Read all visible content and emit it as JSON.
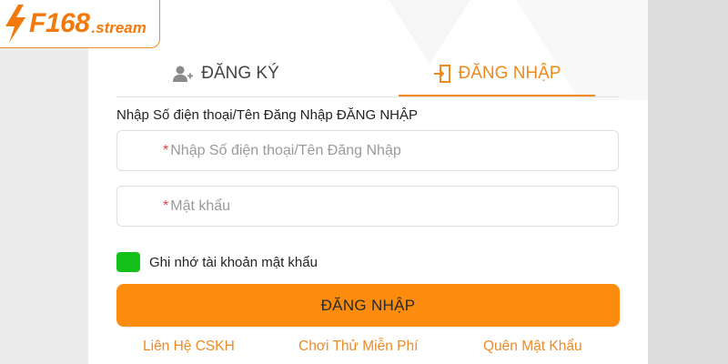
{
  "brand": {
    "name": "F168",
    "suffix": ".stream",
    "color": "#f27a0c"
  },
  "tabs": {
    "register_label": "ĐĂNG KÝ",
    "login_label": "ĐĂNG NHẬP",
    "active": "login"
  },
  "form": {
    "account_label": "Nhập Số điện thoại/Tên Đăng Nhập ĐĂNG NHẬP",
    "phone_placeholder": "Nhập Số điện thoại/Tên Đăng Nhập",
    "password_placeholder": "Mật khẩu",
    "required_mark": "*",
    "remember_label": "Ghi nhớ tài khoản mật khẩu",
    "remember_checked": true,
    "submit_label": "ĐĂNG NHẬP"
  },
  "links": {
    "support": "Liên Hệ CSKH",
    "trial": "Chơi Thử Miễn Phí",
    "forgot": "Quên Mật Khẩu"
  },
  "colors": {
    "accent": "#f08a1c",
    "button": "#fb8c0d",
    "checkbox": "#14c01a",
    "required": "#e0453b"
  },
  "icons": {
    "register": "add-user-icon",
    "login": "login-door-icon",
    "brand": "lightning-bolt-icon"
  }
}
